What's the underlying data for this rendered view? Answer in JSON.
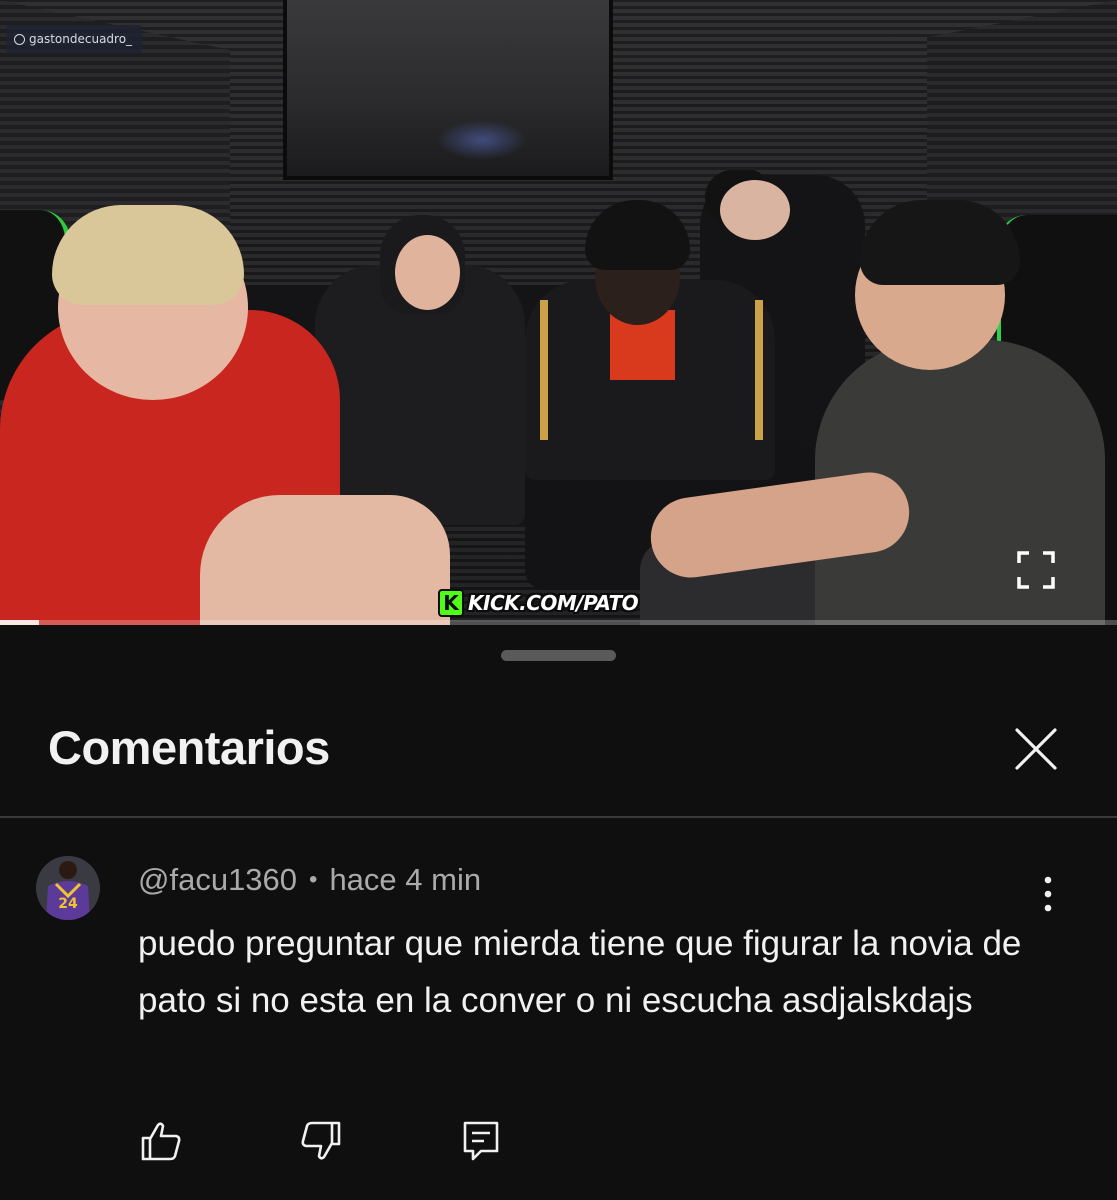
{
  "video": {
    "watermark": "gastondecuadro_",
    "kick_logo_letter": "K",
    "kick_url": "KICK.COM/PATO",
    "progress": 0.035,
    "kick_color": "#53fc18"
  },
  "comments_panel": {
    "title": "Comentarios",
    "close_icon": "close-icon"
  },
  "comment": {
    "author": "@facu1360",
    "separator": "•",
    "time": "hace 4 min",
    "text": "puedo preguntar que mierda tiene que figurar la novia de pato si no esta en la conver o ni escucha asdjalskdajs",
    "avatar_jersey_number": "24",
    "actions": {
      "like_icon": "thumbs-up-icon",
      "dislike_icon": "thumbs-down-icon",
      "reply_icon": "reply-icon",
      "menu_icon": "more-vertical-icon"
    }
  }
}
